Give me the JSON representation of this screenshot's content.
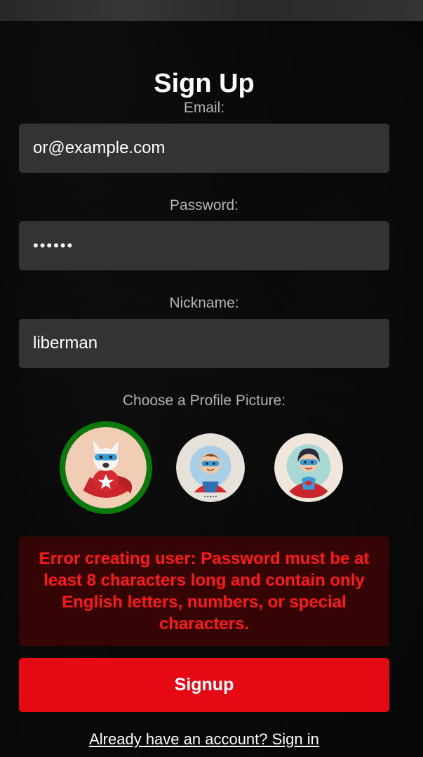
{
  "form": {
    "title": "Sign Up",
    "email_label": "Email:",
    "email_value": "or@example.com",
    "password_label": "Password:",
    "password_value": "••••••",
    "nickname_label": "Nickname:",
    "nickname_value": "liberman",
    "profile_label": "Choose a Profile Picture:",
    "profile_pictures": [
      {
        "name": "dog-superhero",
        "selected": true
      },
      {
        "name": "boy-superhero",
        "selected": false
      },
      {
        "name": "girl-superhero",
        "selected": false
      }
    ],
    "error_message": "Error creating user: Password must be at least 8 characters long and contain only English letters, numbers, or special characters.",
    "signup_label": "Signup",
    "signin_link": "Already have an account? Sign in"
  },
  "colors": {
    "accent": "#e50914",
    "selected_ring": "#0a7a0a",
    "error_text": "#ff1a1a"
  }
}
